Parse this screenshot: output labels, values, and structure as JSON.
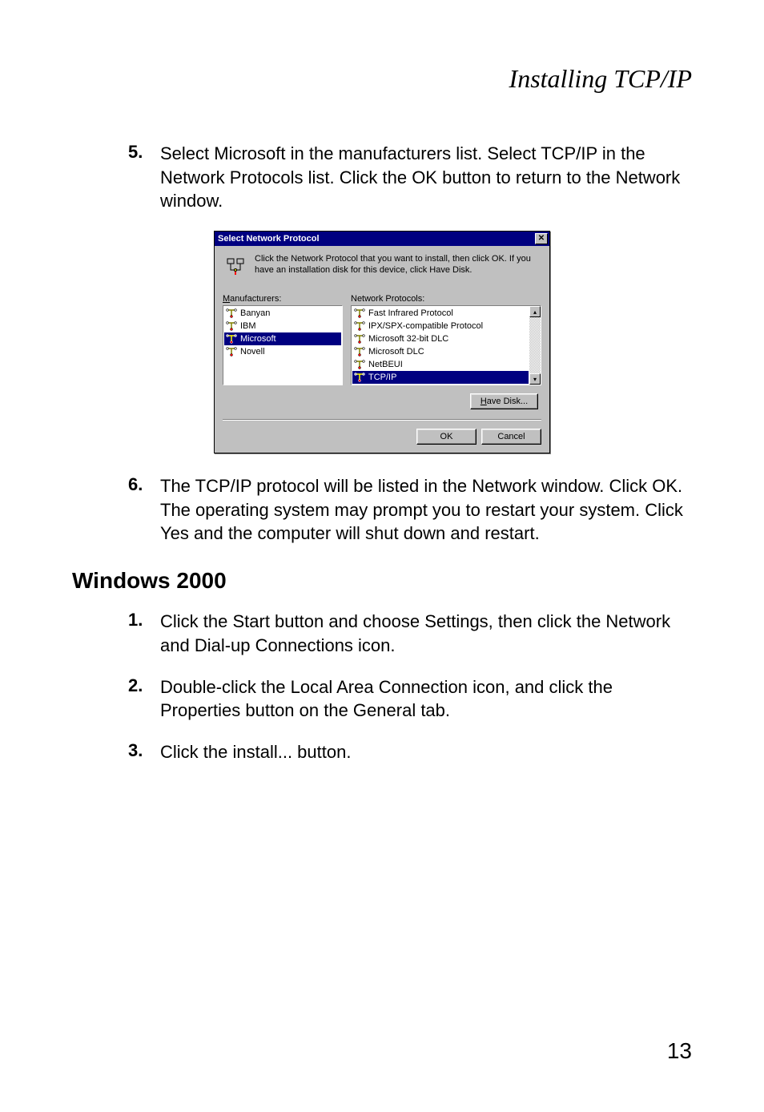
{
  "header": {
    "title": "Installing TCP/IP"
  },
  "steps_top": [
    {
      "num": "5.",
      "text": "Select Microsoft in the manufacturers list. Select TCP/IP in the Network Protocols list. Click the OK button to return to the Network window."
    }
  ],
  "dialog": {
    "title": "Select Network Protocol",
    "close_glyph": "✕",
    "info_text": "Click the Network Protocol that you want to install, then click OK. If you have an installation disk for this device, click Have Disk.",
    "manufacturers_label_pre": "M",
    "manufacturers_label_post": "anufacturers:",
    "protocols_label": "Network Protocols:",
    "manufacturers": [
      {
        "label": "Banyan",
        "selected": false
      },
      {
        "label": "IBM",
        "selected": false
      },
      {
        "label": "Microsoft",
        "selected": true
      },
      {
        "label": "Novell",
        "selected": false
      }
    ],
    "protocols": [
      {
        "label": "Fast Infrared Protocol",
        "selected": false
      },
      {
        "label": "IPX/SPX-compatible Protocol",
        "selected": false
      },
      {
        "label": "Microsoft 32-bit DLC",
        "selected": false
      },
      {
        "label": "Microsoft DLC",
        "selected": false
      },
      {
        "label": "NetBEUI",
        "selected": false
      },
      {
        "label": "TCP/IP",
        "selected": true
      }
    ],
    "have_disk_pre": "H",
    "have_disk_post": "ave Disk...",
    "ok_label": "OK",
    "cancel_label": "Cancel",
    "scroll_up_glyph": "▴",
    "scroll_down_glyph": "▾"
  },
  "steps_mid": [
    {
      "num": "6.",
      "text": "The TCP/IP protocol will be listed in the Network window. Click OK. The operating system may prompt you to restart your system. Click Yes and the computer will shut down and restart."
    }
  ],
  "section": {
    "heading": "Windows 2000"
  },
  "steps_bottom": [
    {
      "num": "1.",
      "text": "Click the Start button and choose Settings, then click the Network and Dial-up Connections icon."
    },
    {
      "num": "2.",
      "text": "Double-click the Local Area Connection icon, and click the Properties button on the General tab."
    },
    {
      "num": "3.",
      "text": "Click the install... button."
    }
  ],
  "page_number": "13"
}
